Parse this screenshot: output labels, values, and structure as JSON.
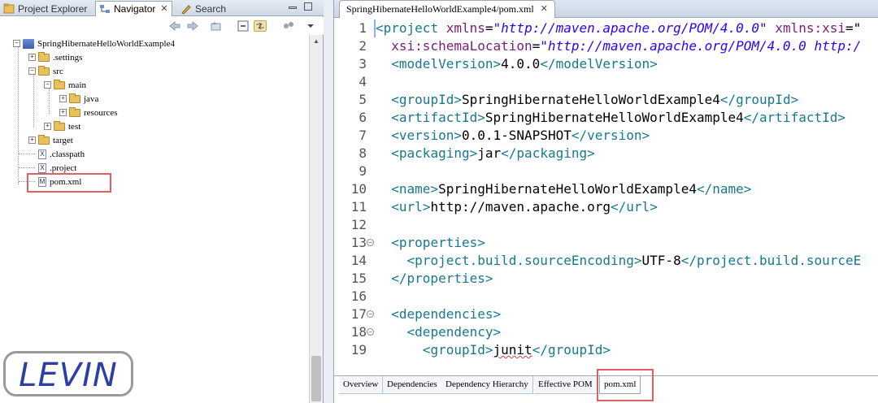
{
  "left": {
    "tabs": [
      {
        "label": "Project Explorer",
        "icon": "project-explorer-icon"
      },
      {
        "label": "Navigator",
        "icon": "navigator-icon",
        "active": true
      },
      {
        "label": "Search",
        "icon": "search-icon"
      }
    ],
    "tree": {
      "project": "SpringHibernateHelloWorldExample4",
      "settings": ".settings",
      "src": "src",
      "main": "main",
      "java": "java",
      "resources": "resources",
      "test": "test",
      "target": "target",
      "classpath": ".classpath",
      "project_file": ".project",
      "pom": "pom.xml"
    },
    "logo_text": "LEVIN"
  },
  "editor": {
    "tab_title": "SpringHibernateHelloWorldExample4/pom.xml",
    "lines": [
      {
        "n": "1",
        "parts": [
          [
            "br",
            "<"
          ],
          [
            "tag",
            "project"
          ],
          [
            "txt",
            " "
          ],
          [
            "attr",
            "xmlns"
          ],
          [
            "txt",
            "="
          ],
          [
            "val",
            "\"http://maven.apache.org/POM/4.0.0\""
          ],
          [
            "txt",
            " "
          ],
          [
            "attr",
            "xmlns:xsi"
          ],
          [
            "txt",
            "=\""
          ]
        ]
      },
      {
        "n": "2",
        "parts": [
          [
            "txt",
            "  "
          ],
          [
            "attr",
            "xsi:schemaLocation"
          ],
          [
            "txt",
            "="
          ],
          [
            "val",
            "\"http://maven.apache.org/POM/4.0.0 http:/"
          ]
        ]
      },
      {
        "n": "3",
        "parts": [
          [
            "txt",
            "  "
          ],
          [
            "br",
            "<"
          ],
          [
            "tag",
            "modelVersion"
          ],
          [
            "br",
            ">"
          ],
          [
            "txt",
            "4.0.0"
          ],
          [
            "br",
            "</"
          ],
          [
            "tag",
            "modelVersion"
          ],
          [
            "br",
            ">"
          ]
        ]
      },
      {
        "n": "4",
        "parts": []
      },
      {
        "n": "5",
        "parts": [
          [
            "txt",
            "  "
          ],
          [
            "br",
            "<"
          ],
          [
            "tag",
            "groupId"
          ],
          [
            "br",
            ">"
          ],
          [
            "txt",
            "SpringHibernateHelloWorldExample4"
          ],
          [
            "br",
            "</"
          ],
          [
            "tag",
            "groupId"
          ],
          [
            "br",
            ">"
          ]
        ]
      },
      {
        "n": "6",
        "parts": [
          [
            "txt",
            "  "
          ],
          [
            "br",
            "<"
          ],
          [
            "tag",
            "artifactId"
          ],
          [
            "br",
            ">"
          ],
          [
            "txt",
            "SpringHibernateHelloWorldExample4"
          ],
          [
            "br",
            "</"
          ],
          [
            "tag",
            "artifactId"
          ],
          [
            "br",
            ">"
          ]
        ]
      },
      {
        "n": "7",
        "parts": [
          [
            "txt",
            "  "
          ],
          [
            "br",
            "<"
          ],
          [
            "tag",
            "version"
          ],
          [
            "br",
            ">"
          ],
          [
            "txt",
            "0.0.1-SNAPSHOT"
          ],
          [
            "br",
            "</"
          ],
          [
            "tag",
            "version"
          ],
          [
            "br",
            ">"
          ]
        ]
      },
      {
        "n": "8",
        "parts": [
          [
            "txt",
            "  "
          ],
          [
            "br",
            "<"
          ],
          [
            "tag",
            "packaging"
          ],
          [
            "br",
            ">"
          ],
          [
            "txt",
            "jar"
          ],
          [
            "br",
            "</"
          ],
          [
            "tag",
            "packaging"
          ],
          [
            "br",
            ">"
          ]
        ]
      },
      {
        "n": "9",
        "parts": []
      },
      {
        "n": "10",
        "parts": [
          [
            "txt",
            "  "
          ],
          [
            "br",
            "<"
          ],
          [
            "tag",
            "name"
          ],
          [
            "br",
            ">"
          ],
          [
            "txt",
            "SpringHibernateHelloWorldExample4"
          ],
          [
            "br",
            "</"
          ],
          [
            "tag",
            "name"
          ],
          [
            "br",
            ">"
          ]
        ]
      },
      {
        "n": "11",
        "parts": [
          [
            "txt",
            "  "
          ],
          [
            "br",
            "<"
          ],
          [
            "tag",
            "url"
          ],
          [
            "br",
            ">"
          ],
          [
            "txt",
            "http://maven.apache.org"
          ],
          [
            "br",
            "</"
          ],
          [
            "tag",
            "url"
          ],
          [
            "br",
            ">"
          ]
        ]
      },
      {
        "n": "12",
        "parts": []
      },
      {
        "n": "13",
        "fold": true,
        "parts": [
          [
            "txt",
            "  "
          ],
          [
            "br",
            "<"
          ],
          [
            "tag",
            "properties"
          ],
          [
            "br",
            ">"
          ]
        ]
      },
      {
        "n": "14",
        "parts": [
          [
            "txt",
            "    "
          ],
          [
            "br",
            "<"
          ],
          [
            "tag",
            "project.build.sourceEncoding"
          ],
          [
            "br",
            ">"
          ],
          [
            "txt",
            "UTF-8"
          ],
          [
            "br",
            "</"
          ],
          [
            "tag",
            "project.build.sourceE"
          ]
        ]
      },
      {
        "n": "15",
        "parts": [
          [
            "txt",
            "  "
          ],
          [
            "br",
            "</"
          ],
          [
            "tag",
            "properties"
          ],
          [
            "br",
            ">"
          ]
        ]
      },
      {
        "n": "16",
        "parts": []
      },
      {
        "n": "17",
        "fold": true,
        "parts": [
          [
            "txt",
            "  "
          ],
          [
            "br",
            "<"
          ],
          [
            "tag",
            "dependencies"
          ],
          [
            "br",
            ">"
          ]
        ]
      },
      {
        "n": "18",
        "fold": true,
        "parts": [
          [
            "txt",
            "    "
          ],
          [
            "br",
            "<"
          ],
          [
            "tag",
            "dependency"
          ],
          [
            "br",
            ">"
          ]
        ]
      },
      {
        "n": "19",
        "parts": [
          [
            "txt",
            "      "
          ],
          [
            "br",
            "<"
          ],
          [
            "tag",
            "groupId"
          ],
          [
            "br",
            ">"
          ],
          [
            "err",
            "junit"
          ],
          [
            "br",
            "</"
          ],
          [
            "tag",
            "groupId"
          ],
          [
            "br",
            ">"
          ]
        ]
      }
    ],
    "bottom_tabs": [
      "Overview",
      "Dependencies",
      "Dependency Hierarchy",
      "Effective POM",
      "pom.xml"
    ],
    "active_bottom_tab": "pom.xml"
  }
}
